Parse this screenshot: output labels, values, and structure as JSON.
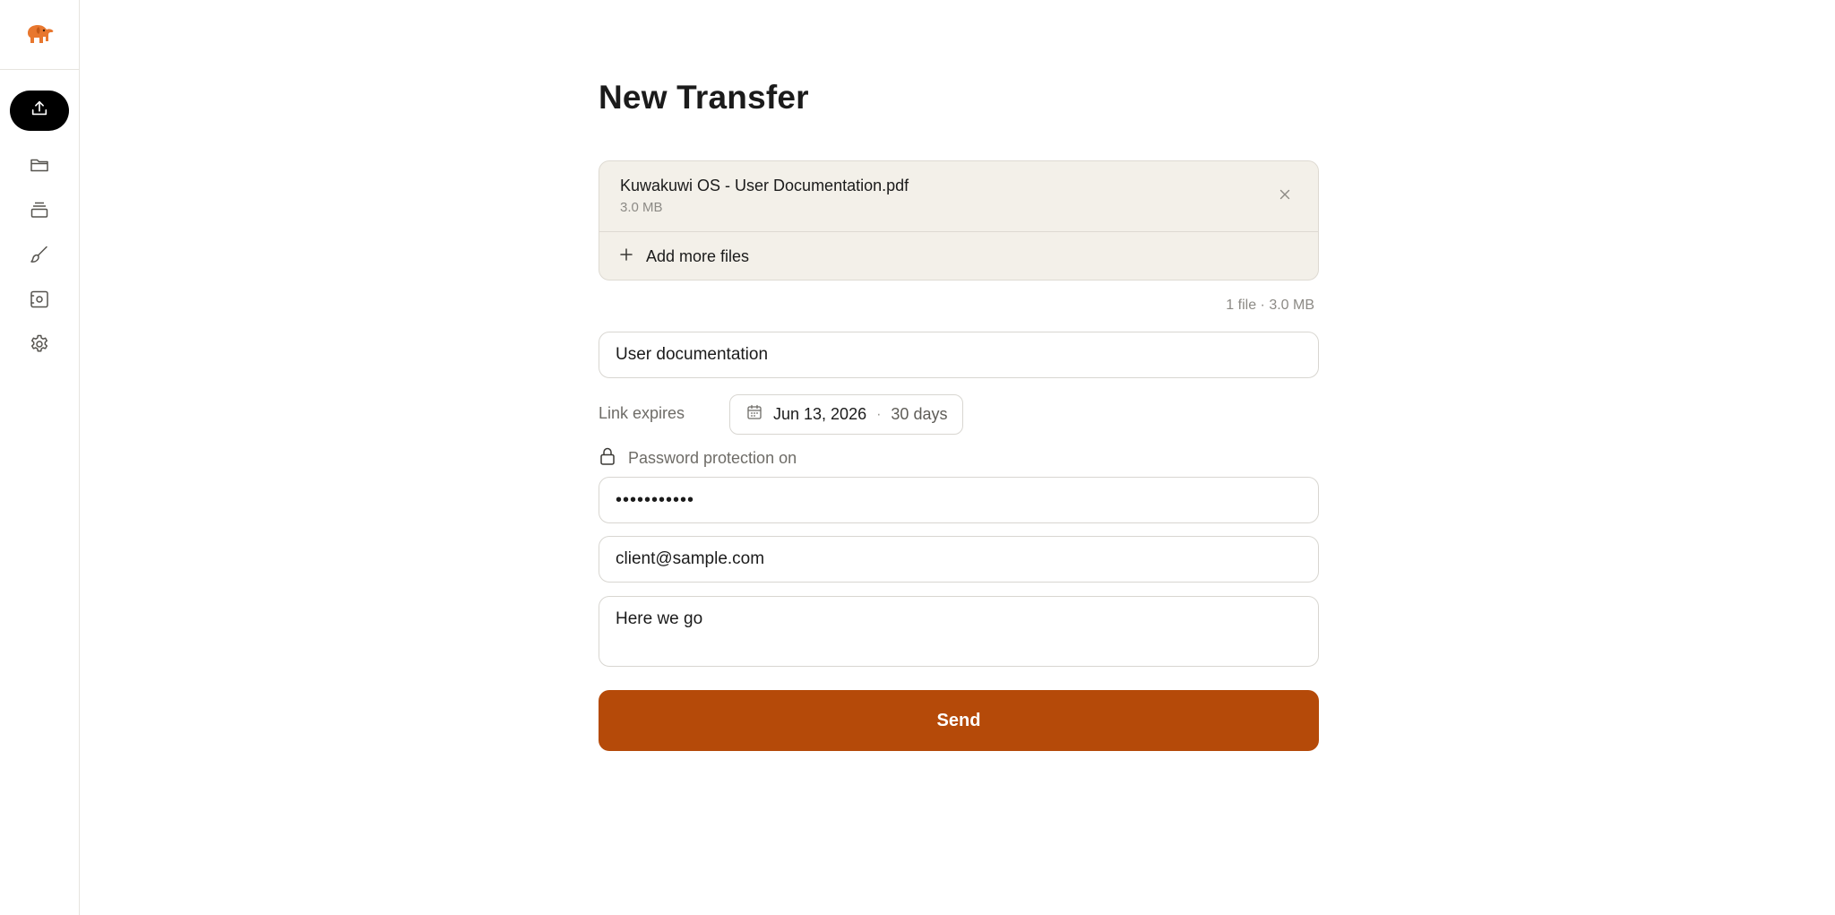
{
  "sidebar": {
    "logo_icon": "elephant-logo",
    "items": [
      {
        "name": "upload",
        "icon": "upload-icon",
        "active": true
      },
      {
        "name": "folder",
        "icon": "folder-icon",
        "active": false
      },
      {
        "name": "archive",
        "icon": "archive-icon",
        "active": false
      },
      {
        "name": "brush",
        "icon": "brush-icon",
        "active": false
      },
      {
        "name": "vault",
        "icon": "vault-icon",
        "active": false
      },
      {
        "name": "settings",
        "icon": "gear-icon",
        "active": false
      }
    ]
  },
  "main": {
    "title": "New Transfer",
    "files": [
      {
        "name": "Kuwakuwi OS - User Documentation.pdf",
        "size": "3.0 MB"
      }
    ],
    "add_more_label": "Add more files",
    "summary": "1 file · 3.0 MB",
    "transfer_title": "User documentation",
    "link_expires_label": "Link expires",
    "expiry_date": "Jun 13, 2026",
    "expiry_separator": "·",
    "expiry_days": "30 days",
    "password_label": "Password protection on",
    "password_value": "•••••••••••",
    "recipient_email": "client@sample.com",
    "message": "Here we go",
    "send_label": "Send"
  },
  "colors": {
    "accent": "#b54a09",
    "logo": "#e8772e",
    "files_bg": "#f3f0e9",
    "active_nav": "#000000"
  }
}
